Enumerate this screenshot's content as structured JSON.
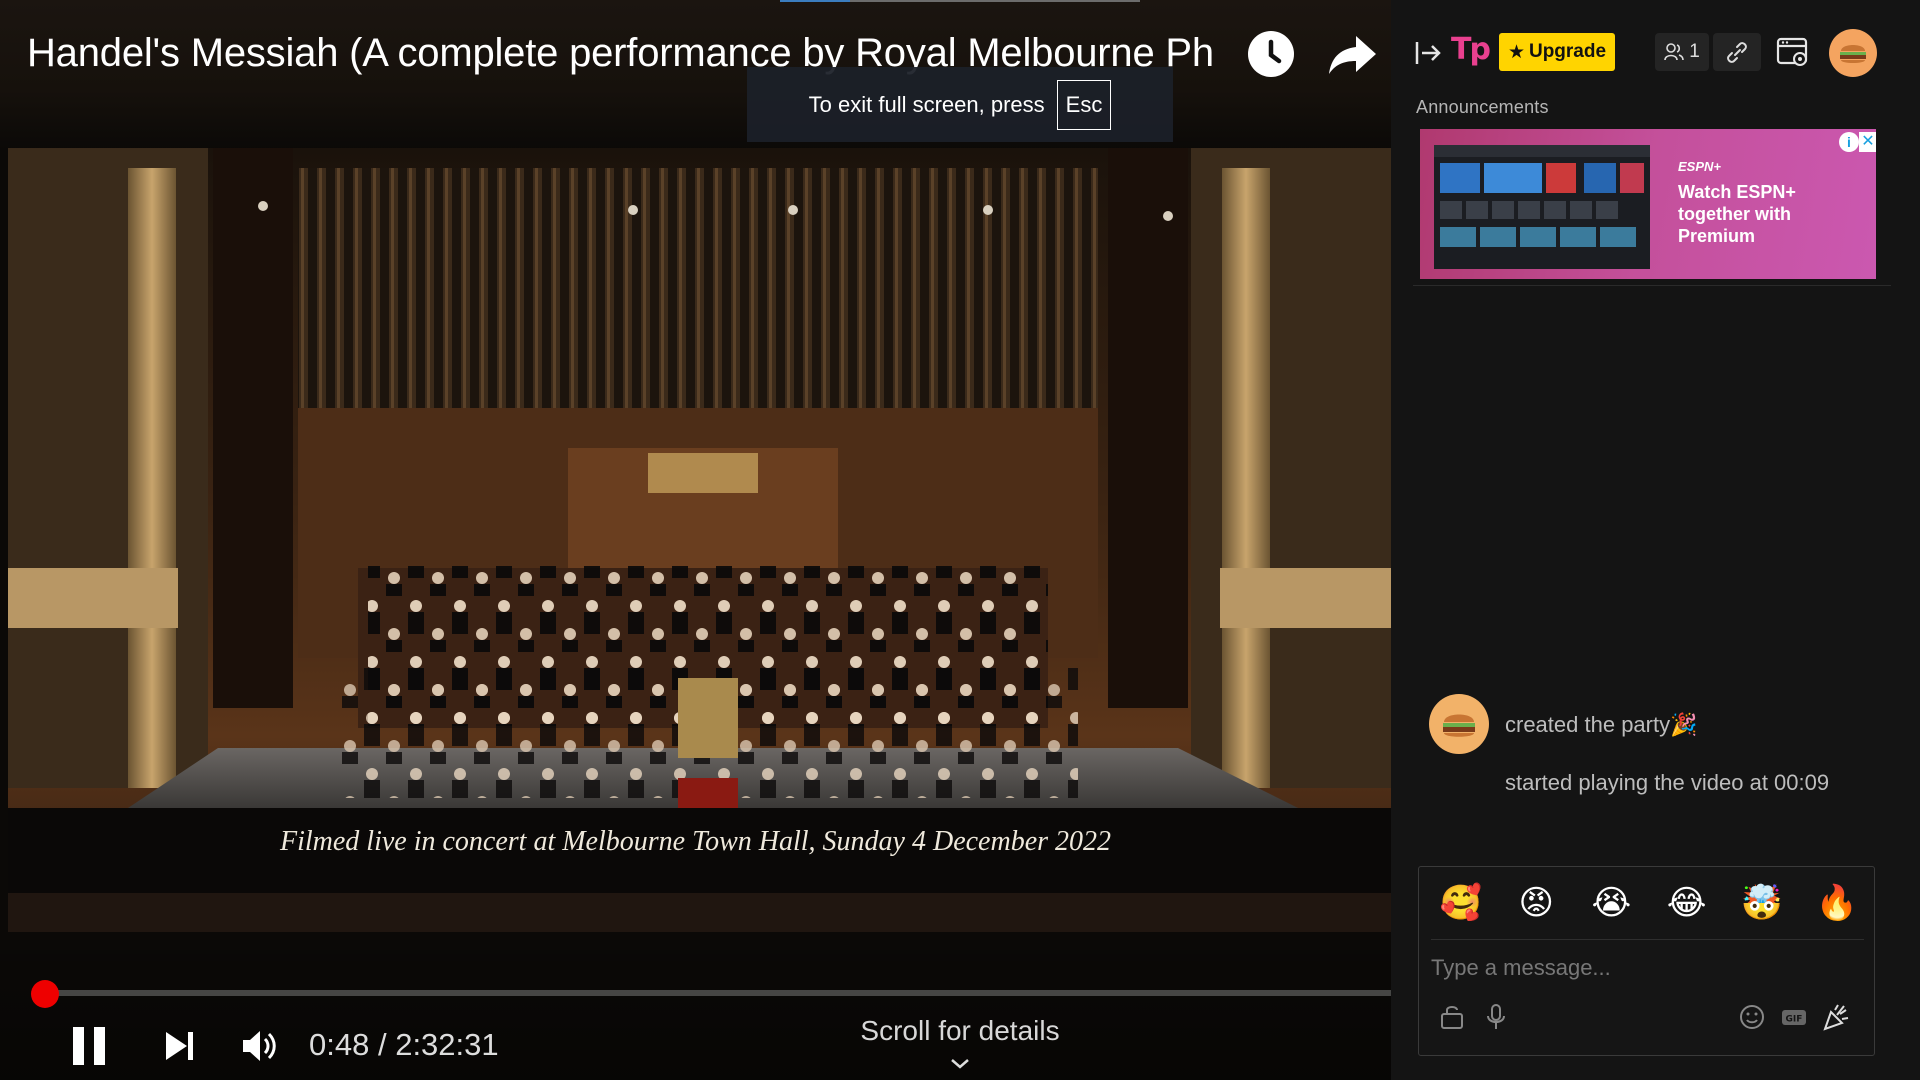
{
  "video": {
    "title": "Handel's Messiah (A complete performance by Royal Melbourne Ph",
    "caption": "Filmed live in concert at Melbourne Town Hall,  Sunday 4 December 2022",
    "fullscreen_toast": {
      "text": "To exit full screen, press",
      "key": "Esc"
    },
    "current_time": "0:48",
    "duration": "2:32:31",
    "progress_fraction": 0.0053,
    "scroll_hint": "Scroll for details",
    "icons": [
      "watch-later-icon",
      "share-icon",
      "pause-icon",
      "next-icon",
      "volume-icon",
      "chevron-down-icon"
    ],
    "accent_color": "#ee0000"
  },
  "sidebar": {
    "logo_text": "Tp",
    "upgrade_label": "Upgrade",
    "participant_count": "1",
    "announcements_label": "Announcements",
    "ad": {
      "brand": "ESPN+",
      "text": "Watch ESPN+ together with Premium",
      "info": "i",
      "close": "✕"
    },
    "chat": {
      "messages": [
        {
          "text": "created the party🎉"
        },
        {
          "text": "started playing the video at 00:09"
        }
      ],
      "reactions": [
        "🥰",
        "😡",
        "😭",
        "😂",
        "🤯",
        "🔥"
      ],
      "input_placeholder": "Type a message...",
      "icons": [
        "lock-icon",
        "microphone-icon",
        "emoji-icon",
        "gif-icon",
        "party-popper-icon"
      ]
    },
    "colors": {
      "logo": "#e9408f",
      "upgrade_bg": "#ffd400",
      "avatar": "#f4a460"
    }
  }
}
